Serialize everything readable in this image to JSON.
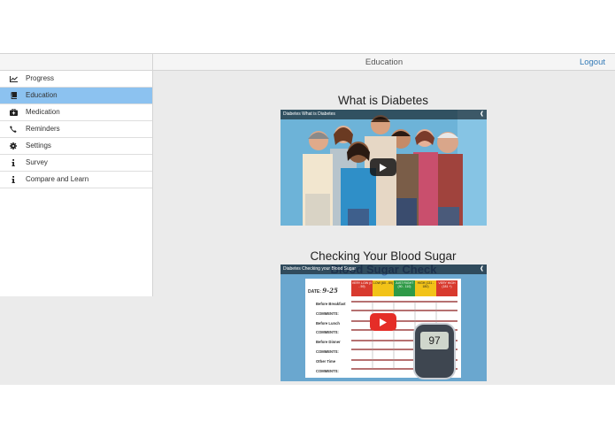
{
  "header": {
    "title": "Education",
    "logout_label": "Logout"
  },
  "sidebar": {
    "items": [
      {
        "label": "Progress",
        "icon": "chart-line-icon",
        "active": false
      },
      {
        "label": "Education",
        "icon": "book-icon",
        "active": true
      },
      {
        "label": "Medication",
        "icon": "medkit-icon",
        "active": false
      },
      {
        "label": "Reminders",
        "icon": "phone-icon",
        "active": false
      },
      {
        "label": "Settings",
        "icon": "gear-icon",
        "active": false
      },
      {
        "label": "Survey",
        "icon": "info-icon",
        "active": false
      },
      {
        "label": "Compare and Learn",
        "icon": "info-icon",
        "active": false
      }
    ]
  },
  "videos": [
    {
      "heading": "What is Diabetes",
      "player_title": "Diabetes What is Diabetes"
    },
    {
      "heading": "Checking Your Blood Sugar",
      "player_title": "Diabetes Checking your Blood Sugar",
      "overlay_text": "Blood Sugar Check",
      "log_sheet": {
        "date_label": "DATE:",
        "date_value": "9-25",
        "columns": [
          "VERY LOW (0 - 59)",
          "LOW (60 - 89)",
          "JUST RIGHT (90 - 110)",
          "HIGH (131 - 180)",
          "VERY HIGH (181 +)"
        ],
        "rows": [
          "Before Breakfast",
          "COMMENTS:",
          "Before Lunch",
          "COMMENTS:",
          "Before Dinner",
          "COMMENTS:",
          "Other Time",
          "COMMENTS:"
        ],
        "meter_reading": "97"
      }
    }
  ],
  "colors": {
    "accent": "#337ab7",
    "active_nav": "#8cc2f0",
    "video1_bg": "#6db3d8",
    "video2_bg": "#6aa7cf",
    "youtube_red": "#e52d27"
  }
}
